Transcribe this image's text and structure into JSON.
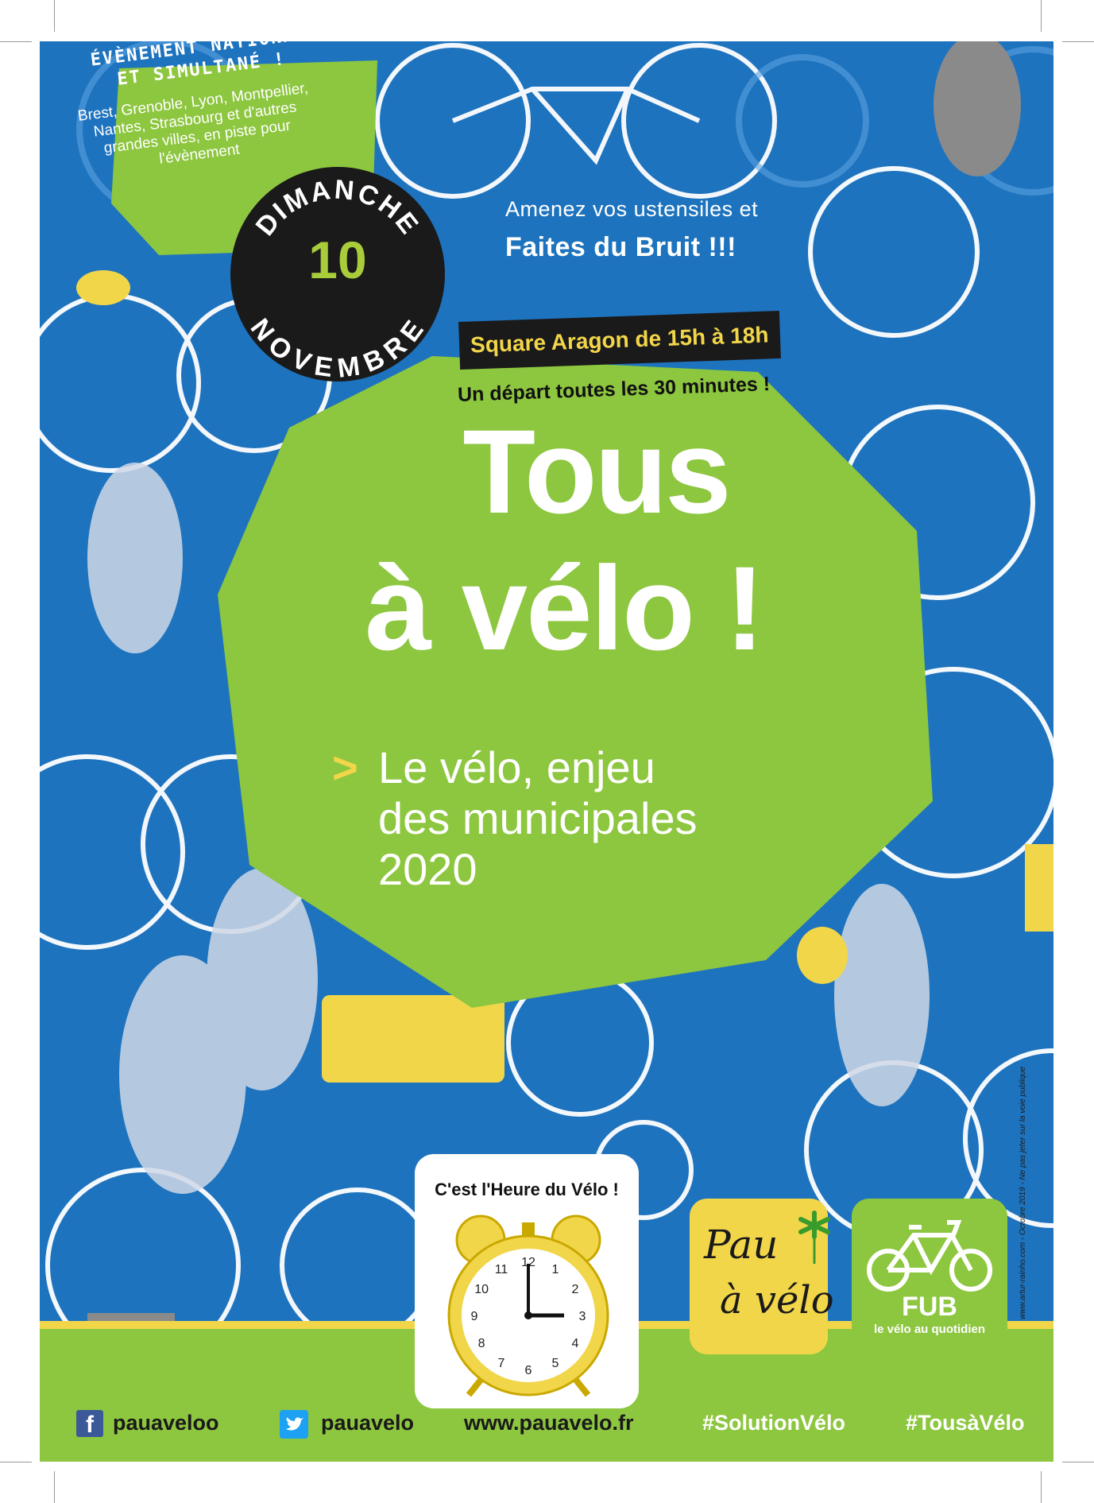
{
  "event_box": {
    "title": "ÉVÈNEMENT NATIONAL ET SIMULTANÉ !",
    "text": "Brest, Grenoble, Lyon, Montpellier, Nantes, Strasbourg et d'autres grandes villes, en piste pour l'évènement"
  },
  "date": {
    "day_name": "DIMANCHE",
    "day_number": "10",
    "month": "NOVEMBRE"
  },
  "noise": {
    "line1": "Amenez vos ustensiles et",
    "line2": "Faites du Bruit !!!"
  },
  "location": "Square Aragon de 15h à 18h",
  "departure": "Un départ toutes les 30 minutes !",
  "headline": {
    "line1": "Tous",
    "line2": "à vélo !"
  },
  "subtitle": {
    "arrow": ">",
    "line1": "Le vélo, enjeu",
    "line2": "des municipales",
    "line3": "2020"
  },
  "clock": {
    "caption": "C'est l'Heure du Vélo !",
    "time": "3:00",
    "numbers": [
      "12",
      "1",
      "2",
      "3",
      "4",
      "5",
      "6",
      "7",
      "8",
      "9",
      "10",
      "11"
    ]
  },
  "pau_logo": {
    "line1": "Pau",
    "line2": "à vélo"
  },
  "fub_logo": {
    "name": "FUB",
    "tagline": "le vélo au quotidien"
  },
  "credit": "www.artur-rainho.com - Octobre 2019 - Ne pas jeter sur la voie publique",
  "footer": {
    "facebook": "pauaveloo",
    "twitter": "pauavelo",
    "website": "www.pauavelo.fr",
    "hashtag1": "#SolutionVélo",
    "hashtag2": "#TousàVélo"
  },
  "colors": {
    "background_blue": "#1e73be",
    "green": "#8dc63f",
    "yellow": "#f2d64a",
    "black": "#1a1a1a"
  }
}
